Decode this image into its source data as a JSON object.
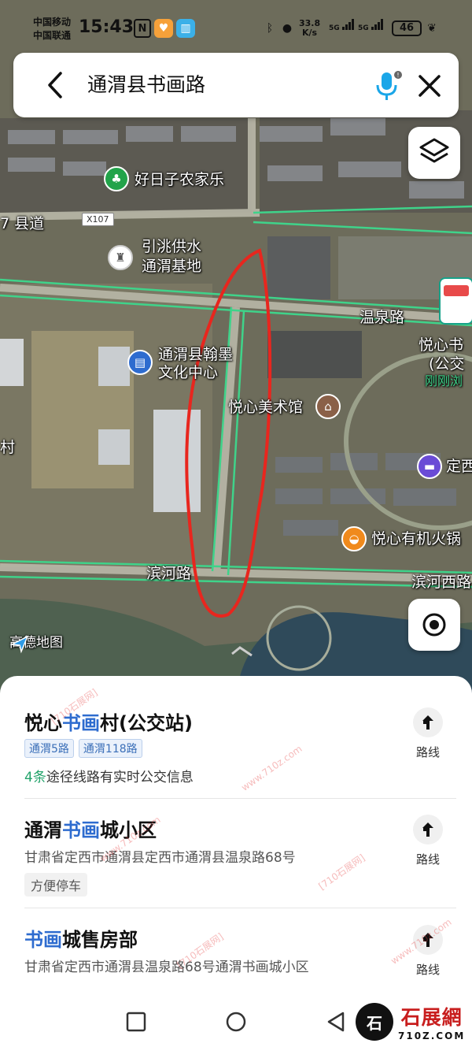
{
  "status_bar": {
    "carrier1": "中国移动",
    "carrier2": "中国联通",
    "time": "15:43",
    "net_speed_value": "33.8",
    "net_speed_unit": "K/s",
    "signal1": "5G",
    "signal2": "5G",
    "battery": "46"
  },
  "search": {
    "query": "通渭县书画路"
  },
  "map": {
    "labels": {
      "haorizi": "好日子农家乐",
      "county_road": "7 县道",
      "road_code": "X107",
      "yintao_1": "引洮供水",
      "yintao_2": "通渭基地",
      "wenquan_road": "温泉路",
      "hanmo_1": "通渭县翰墨",
      "hanmo_2": "文化中心",
      "yuexin_art": "悦心美术馆",
      "yuexin_bus_1": "悦心书",
      "yuexin_bus_2": "(公交",
      "just_now": "刚刚浏",
      "dingxi": "定西",
      "hotpot": "悦心有机火锅",
      "binhe_road": "滨河路",
      "binhe_west": "滨河西路",
      "cun": "村"
    },
    "logo": "高德地图"
  },
  "results": [
    {
      "title_pre": "悦心",
      "title_hl": "书画",
      "title_post": "村(公交站)",
      "tags": [
        "通渭5路",
        "通渭118路"
      ],
      "info_num": "4条",
      "info_text": "途径线路有实时公交信息",
      "route_label": "路线"
    },
    {
      "title_pre": "通渭",
      "title_hl": "书画",
      "title_post": "城小区",
      "address": "甘肃省定西市通渭县定西市通渭县温泉路68号",
      "chip": "方便停车",
      "route_label": "路线"
    },
    {
      "title_pre": "",
      "title_hl": "书画",
      "title_post": "城售房部",
      "address": "甘肃省定西市通渭县温泉路68号通渭书画城小区",
      "route_label": "路线"
    }
  ],
  "watermark": {
    "text1": "[710石展网]",
    "text2": "www.710z.com"
  },
  "brand": {
    "glyph": "石",
    "name": "石展網",
    "url": "710Z.COM"
  },
  "colors": {
    "accent_blue": "#2e6ccf",
    "green_count": "#23a36b",
    "road_highlight": "#3fd38a",
    "annotation_red": "#e8261e"
  }
}
